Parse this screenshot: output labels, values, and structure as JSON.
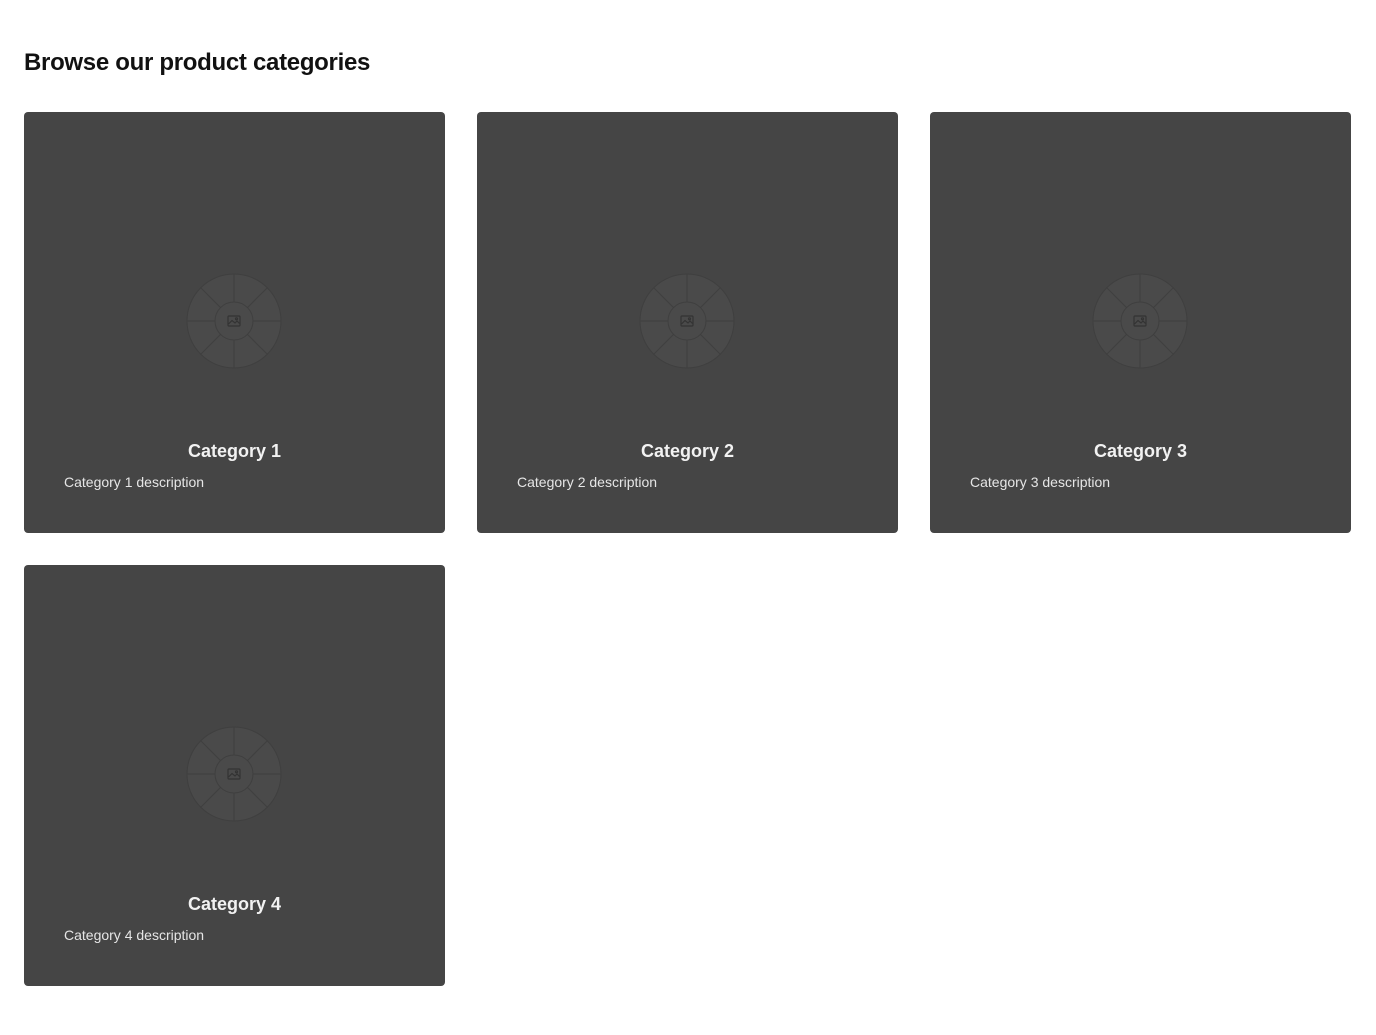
{
  "section": {
    "title": "Browse our product categories"
  },
  "categories": [
    {
      "title": "Category 1",
      "description": "Category 1 description",
      "icon": "image-placeholder-icon"
    },
    {
      "title": "Category 2",
      "description": "Category 2 description",
      "icon": "image-placeholder-icon"
    },
    {
      "title": "Category 3",
      "description": "Category 3 description",
      "icon": "image-placeholder-icon"
    },
    {
      "title": "Category 4",
      "description": "Category 4 description",
      "icon": "image-placeholder-icon"
    }
  ],
  "colors": {
    "card_background": "#454545",
    "card_text": "#f2f2f2",
    "heading_text": "#111111"
  }
}
